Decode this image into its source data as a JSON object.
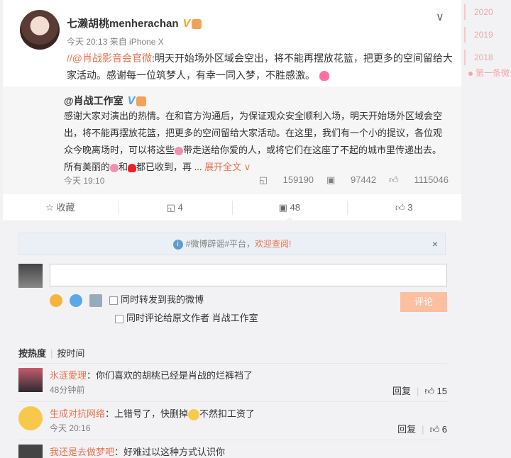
{
  "sidebar_years": {
    "y2020": "2020",
    "y2019": "2019",
    "y2018": "2018",
    "first": "第一条微"
  },
  "post": {
    "username": "七濑胡桃menherachan",
    "vmark": "V",
    "meta": "今天 20:13 来自 iPhone X",
    "prefix": "//",
    "mention": "@肖战影音会官微",
    "text": ":明天开始场外区域会空出，将不能再摆放花篮，把更多的空间留给大家活动。感谢每一位筑梦人，有幸一同入梦，不胜感激。"
  },
  "repost": {
    "user": "@肖战工作室",
    "vmark": "V",
    "text1": "感谢大家对演出的热情。在和官方沟通后，为保证观众安全顺利入场，明天开始场外区域会空出，将不能再摆放花篮，把更多的空间留给大家活动。在这里，我们有一个小的提议，各位观众今晚离场时，可以将这些",
    "text2": "带走送给你爱的人，或将它们在这座了不起的城市里传递出去。所有美丽的",
    "text3": "和",
    "text4": "都已收到，再 ...",
    "expand": "展开全文",
    "time": "今天 19:10",
    "reposts": "159190",
    "comments": "97442",
    "likes": "1115046"
  },
  "actions": {
    "favorite": "收藏",
    "repost": "4",
    "comment": "48",
    "like": "3"
  },
  "notice": {
    "tag": "#微博辟谣#平台，",
    "cta": "欢迎查阅!",
    "close": "×"
  },
  "composer": {
    "sync_weibo": "同时转发到我的微博",
    "sync_author": "同时评论给原文作者 肖战工作室",
    "submit": "评论"
  },
  "sort": {
    "hot": "按热度",
    "time": "按时间"
  },
  "comments": [
    {
      "name": "氷涟愛理",
      "text": "：你们喜欢的胡桃已经是肖战的烂裤裆了",
      "time": "48分钟前",
      "reply": "回复",
      "likes": "15"
    },
    {
      "name": "生成对抗网络",
      "text": "：上错号了，快删掉",
      "text_after": "不然扣工资了",
      "time": "今天 20:16",
      "reply": "回复",
      "likes": "6"
    },
    {
      "name": "我还是去做梦吧",
      "text": "：好难过以这种方式认识你"
    }
  ]
}
